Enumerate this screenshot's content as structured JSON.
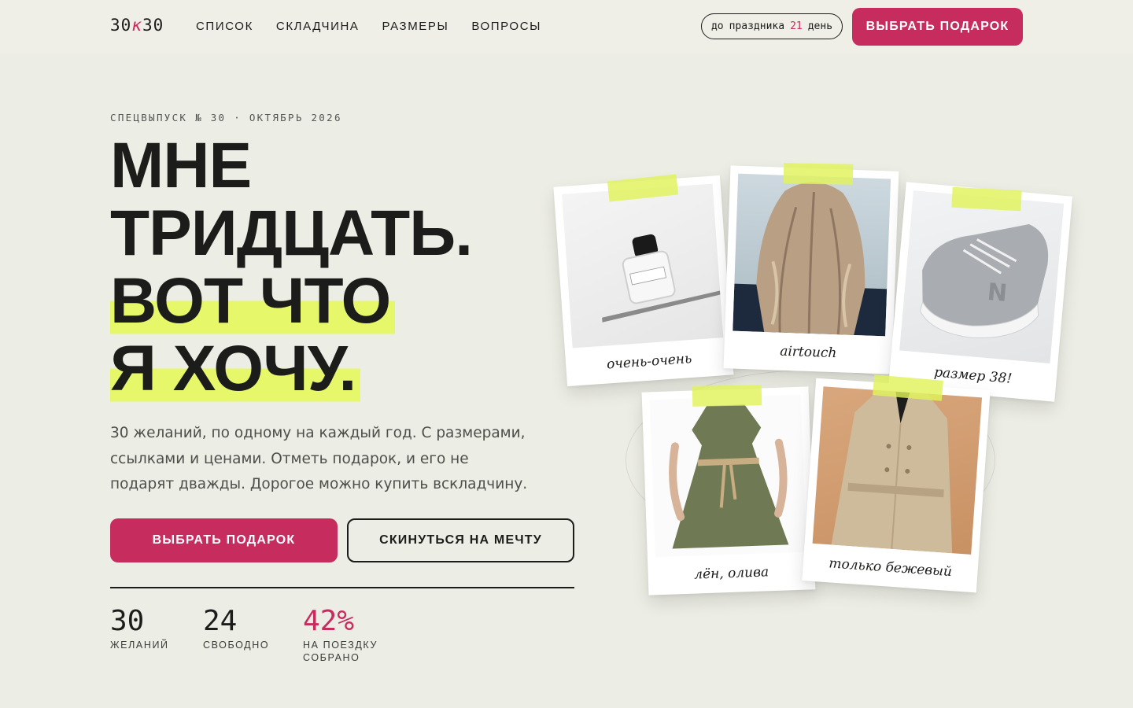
{
  "header": {
    "logo": {
      "left": "30",
      "mid": "к",
      "right": "30"
    },
    "nav": [
      "СПИСОК",
      "СКЛАДЧИНА",
      "РАЗМЕРЫ",
      "ВОПРОСЫ"
    ],
    "countdown": {
      "prefix": "до",
      "label": "праздника",
      "days": "21",
      "unit": "день"
    },
    "cta": "ВЫБРАТЬ ПОДАРОК"
  },
  "hero": {
    "kicker": "СПЕЦВЫПУСК № 30 · ОКТЯБРЬ 2026",
    "headline": [
      "МНЕ",
      "ТРИДЦАТЬ.",
      "ВОТ ЧТО",
      "Я ХОЧУ."
    ],
    "lead": "30 желаний, по одному на каждый год. С размерами, ссылками и ценами. Отметь подарок, и его не подарят дважды. Дорогое можно купить вскладчину.",
    "primary_button": "ВЫБРАТЬ ПОДАРОК",
    "secondary_button": "СКИНУТЬСЯ НА МЕЧТУ"
  },
  "stats": [
    {
      "value": "30",
      "label": "ЖЕЛАНИЙ"
    },
    {
      "value": "24",
      "label": "СВОБОДНО"
    },
    {
      "value": "42%",
      "label": "НА ПОЕЗДКУ СОБРАНО"
    }
  ],
  "polaroids": [
    {
      "caption": "очень-очень",
      "icon": "perfume-bottle"
    },
    {
      "caption": "airtouch",
      "icon": "long-hair"
    },
    {
      "caption": "размер 38!",
      "icon": "sneaker"
    },
    {
      "caption": "лён, олива",
      "icon": "olive-dress"
    },
    {
      "caption": "только бежевый",
      "icon": "beige-trench"
    }
  ],
  "colors": {
    "background": "#ecede4",
    "accent": "#c72c5f",
    "highlight": "#e6f76a",
    "text": "#1c1c1a"
  }
}
